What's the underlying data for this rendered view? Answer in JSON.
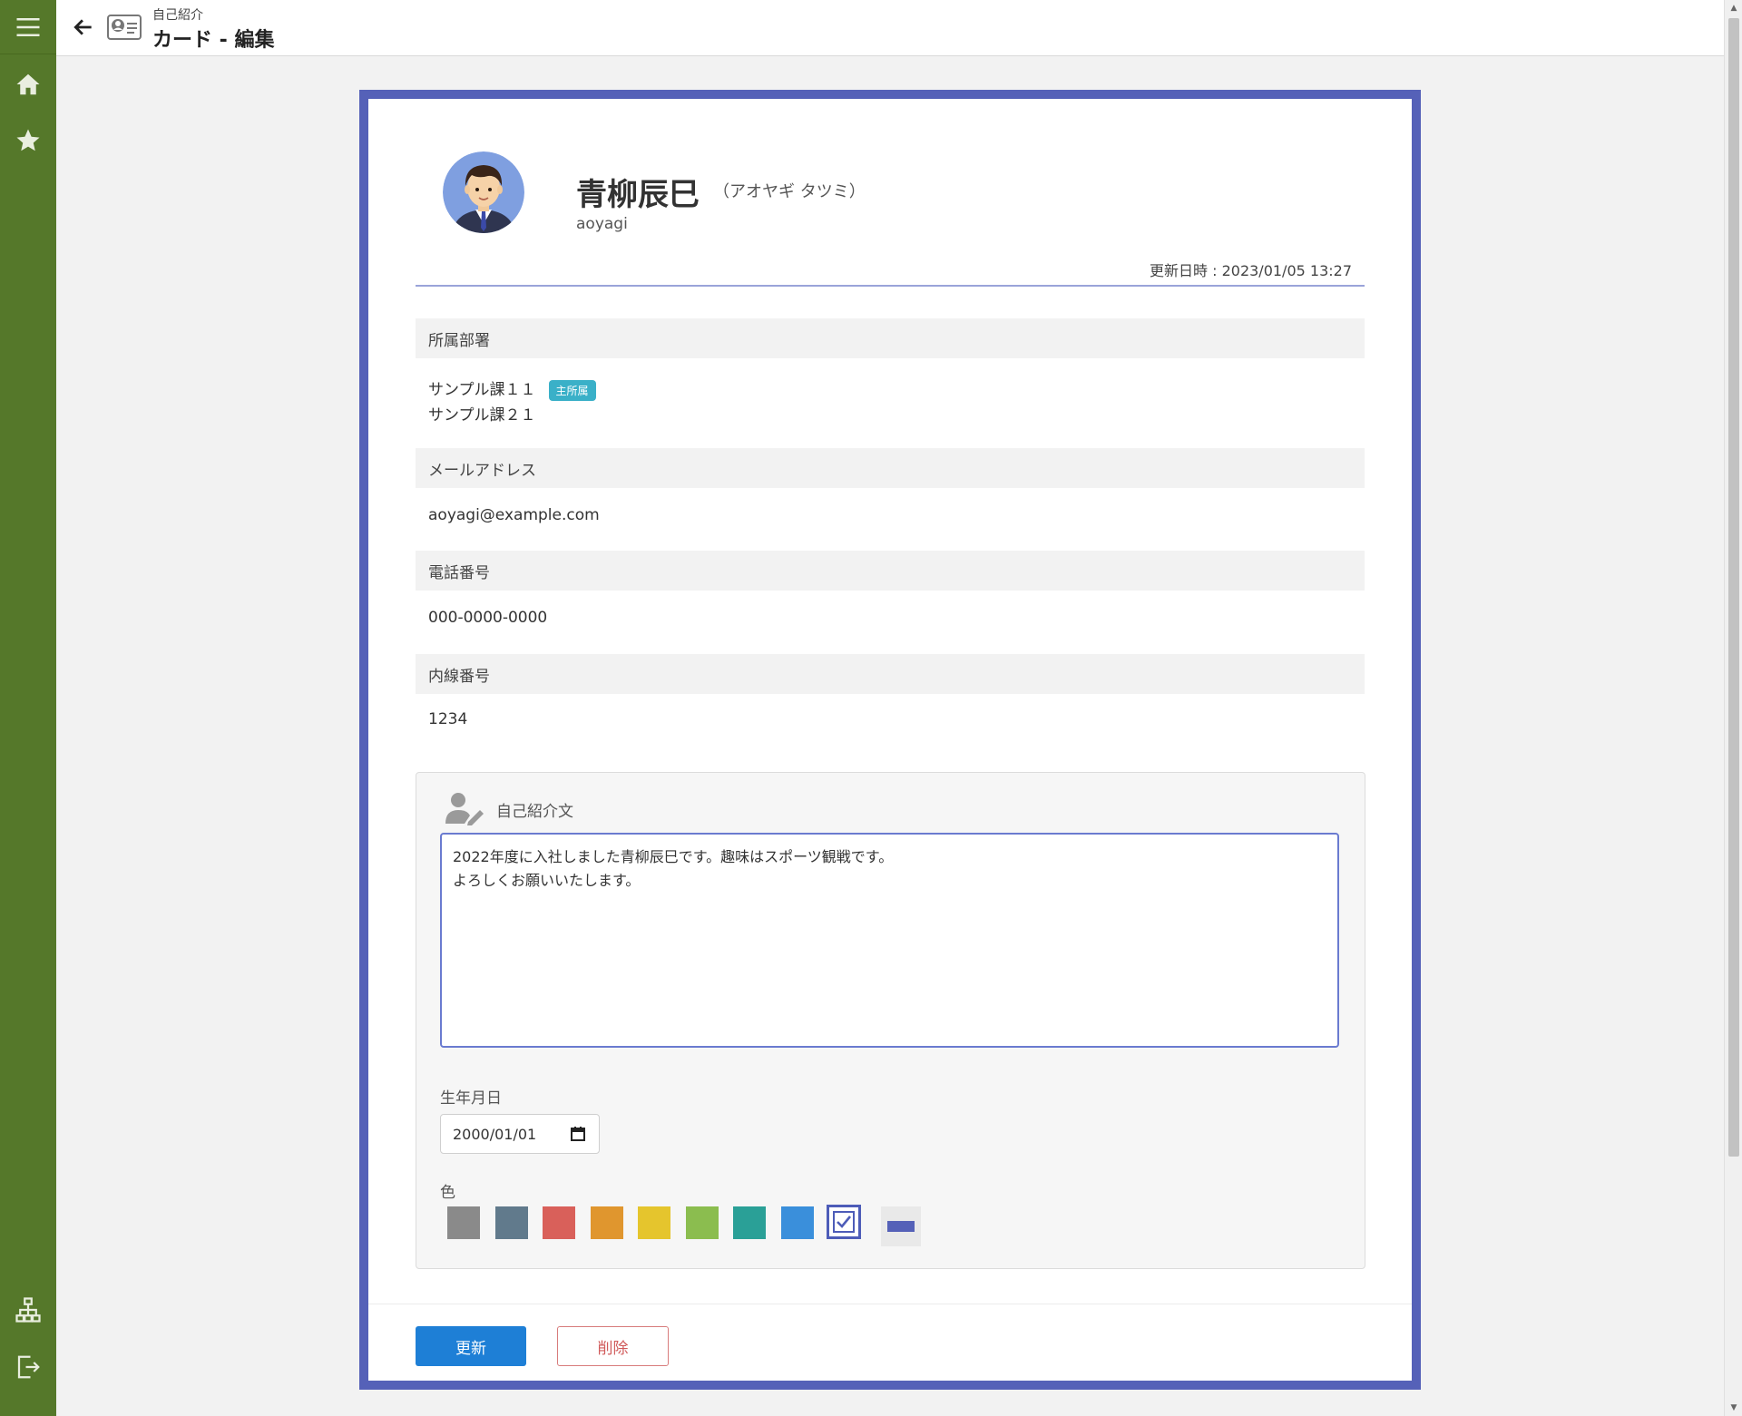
{
  "header": {
    "subtitle": "自己紹介",
    "title": "カード - 編集"
  },
  "profile": {
    "name": "青柳辰巳",
    "kana": "（アオヤギ タツミ）",
    "user_id": "aoyagi",
    "updated": "更新日時 : 2023/01/05 13:27"
  },
  "sections": {
    "department": {
      "label": "所属部署",
      "items": [
        {
          "name": "サンプル課１１",
          "badge": "主所属"
        },
        {
          "name": "サンプル課２１"
        }
      ]
    },
    "email": {
      "label": "メールアドレス",
      "value": "aoyagi@example.com"
    },
    "phone": {
      "label": "電話番号",
      "value": "000-0000-0000"
    },
    "extension": {
      "label": "内線番号",
      "value": "1234"
    }
  },
  "intro": {
    "label": "自己紹介文",
    "text": "2022年度に入社しました青柳辰巳です。趣味はスポーツ観戦です。\nよろしくお願いいたします。"
  },
  "birthday": {
    "label": "生年月日",
    "value": "2000/01/01"
  },
  "color": {
    "label": "色",
    "swatches": [
      "#8a8a8a",
      "#617a8c",
      "#d9605a",
      "#e0962e",
      "#e5c52d",
      "#8bbd4f",
      "#2aa097",
      "#3a8fdb",
      "#4d5cb8"
    ],
    "selected_index": 8,
    "frame_color": "#5561b8"
  },
  "buttons": {
    "update": "更新",
    "delete": "削除"
  },
  "colors": {
    "sidebar": "#55782a",
    "accent": "#5561b8",
    "primary_button": "#1e7fd6",
    "badge": "#3ab0c8"
  }
}
